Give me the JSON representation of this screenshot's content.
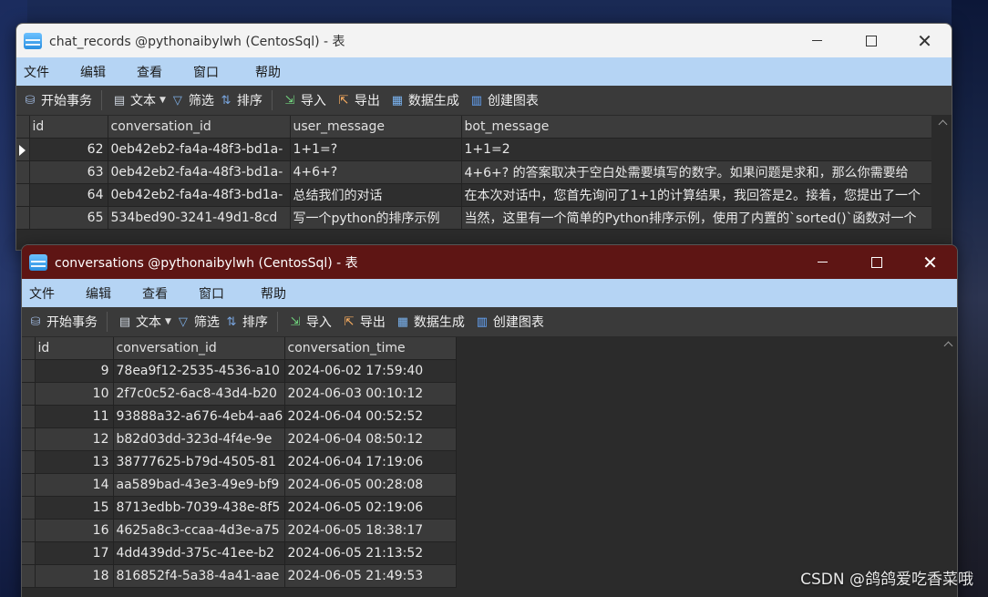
{
  "windows": [
    {
      "title": "chat_records @pythonaibylwh (CentosSql) - 表",
      "menu": [
        "文件",
        "编辑",
        "查看",
        "窗口",
        "帮助"
      ],
      "toolbar": {
        "begin_transaction": "开始事务",
        "text": "文本",
        "filter": "筛选",
        "sort": "排序",
        "import": "导入",
        "export": "导出",
        "data_generation": "数据生成",
        "create_chart": "创建图表"
      },
      "columns": [
        "id",
        "conversation_id",
        "user_message",
        "bot_message"
      ],
      "rows": [
        {
          "id": "62",
          "conversation_id": "0eb42eb2-fa4a-48f3-bd1a-",
          "user_message": "1+1=?",
          "bot_message": "1+1=2"
        },
        {
          "id": "63",
          "conversation_id": "0eb42eb2-fa4a-48f3-bd1a-",
          "user_message": "4+6+?",
          "bot_message": "4+6+? 的答案取决于空白处需要填写的数字。如果问题是求和，那么你需要给"
        },
        {
          "id": "64",
          "conversation_id": "0eb42eb2-fa4a-48f3-bd1a-",
          "user_message": "总结我们的对话",
          "bot_message": "在本次对话中，您首先询问了1+1的计算结果，我回答是2。接着，您提出了一个"
        },
        {
          "id": "65",
          "conversation_id": "534bed90-3241-49d1-8cd",
          "user_message": "写一个python的排序示例",
          "bot_message": "当然，这里有一个简单的Python排序示例，使用了内置的`sorted()`函数对一个"
        }
      ]
    },
    {
      "title": "conversations @pythonaibylwh (CentosSql) - 表",
      "menu": [
        "文件",
        "编辑",
        "查看",
        "窗口",
        "帮助"
      ],
      "toolbar": {
        "begin_transaction": "开始事务",
        "text": "文本",
        "filter": "筛选",
        "sort": "排序",
        "import": "导入",
        "export": "导出",
        "data_generation": "数据生成",
        "create_chart": "创建图表"
      },
      "columns": [
        "id",
        "conversation_id",
        "conversation_time"
      ],
      "rows": [
        {
          "id": "9",
          "conversation_id": "78ea9f12-2535-4536-a10",
          "conversation_time": "2024-06-02 17:59:40"
        },
        {
          "id": "10",
          "conversation_id": "2f7c0c52-6ac8-43d4-b20",
          "conversation_time": "2024-06-03 00:10:12"
        },
        {
          "id": "11",
          "conversation_id": "93888a32-a676-4eb4-aa6",
          "conversation_time": "2024-06-04 00:52:52"
        },
        {
          "id": "12",
          "conversation_id": "b82d03dd-323d-4f4e-9e",
          "conversation_time": "2024-06-04 08:50:12"
        },
        {
          "id": "13",
          "conversation_id": "38777625-b79d-4505-81",
          "conversation_time": "2024-06-04 17:19:06"
        },
        {
          "id": "14",
          "conversation_id": "aa589bad-43e3-49e9-bf9",
          "conversation_time": "2024-06-05 00:28:08"
        },
        {
          "id": "15",
          "conversation_id": "8713edbb-7039-438e-8f5",
          "conversation_time": "2024-06-05 02:19:06"
        },
        {
          "id": "16",
          "conversation_id": "4625a8c3-ccaa-4d3e-a75",
          "conversation_time": "2024-06-05 18:38:17"
        },
        {
          "id": "17",
          "conversation_id": "4dd439dd-375c-41ee-b2",
          "conversation_time": "2024-06-05 21:13:52"
        },
        {
          "id": "18",
          "conversation_id": "816852f4-5a38-4a41-aae",
          "conversation_time": "2024-06-05 21:49:53"
        }
      ]
    }
  ],
  "watermark": "CSDN @鸽鸽爱吃香菜哦",
  "colors": {
    "menubar": "#b5d4f4",
    "active_titlebar": "#5e1514",
    "inactive_titlebar": "#f3f3f3",
    "toolbar": "#3a3a3a",
    "grid_bg": "#2b2b2b"
  }
}
